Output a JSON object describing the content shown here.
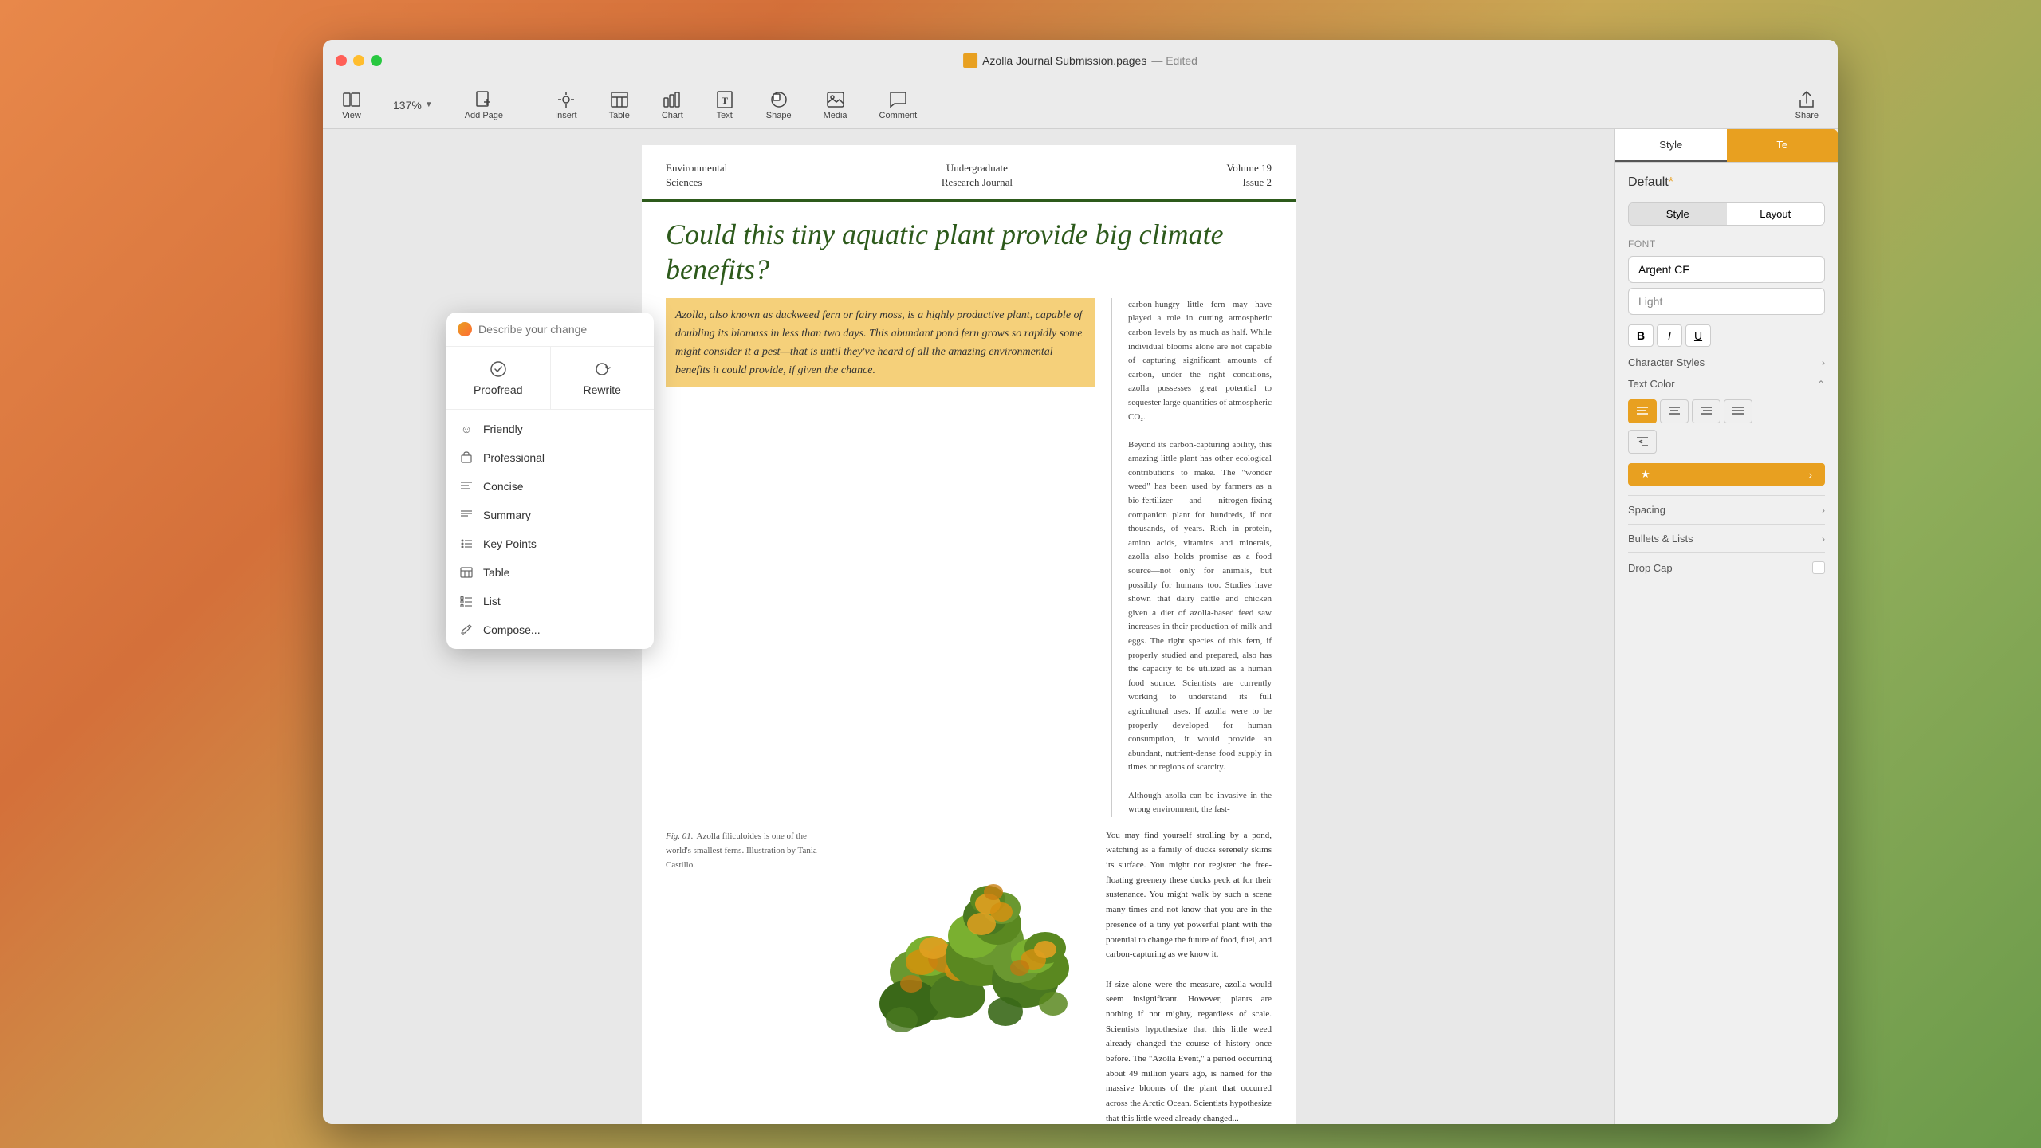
{
  "window": {
    "title": "Azolla Journal Submission.pages",
    "edited_label": "— Edited"
  },
  "toolbar": {
    "view_label": "View",
    "zoom_label": "137%",
    "add_page_label": "Add Page",
    "insert_label": "Insert",
    "table_label": "Table",
    "chart_label": "Chart",
    "text_label": "Text",
    "shape_label": "Shape",
    "media_label": "Media",
    "comment_label": "Comment",
    "share_label": "Share"
  },
  "format_panel": {
    "style_tab": "Style",
    "text_tab": "Te",
    "default_label": "Default",
    "style_label": "Style",
    "layout_label": "Layout",
    "font_section": "Font",
    "font_name": "Argent CF",
    "font_weight": "Light",
    "char_styles_label": "Character Styles",
    "text_color_label": "Text Color",
    "spacing_label": "Spacing",
    "bullets_label": "Bullets & Lists",
    "drop_cap_label": "Drop Cap"
  },
  "ai_popup": {
    "placeholder": "Describe your change",
    "proofread_label": "Proofread",
    "rewrite_label": "Rewrite",
    "menu_items": [
      {
        "icon": "smiley",
        "label": "Friendly"
      },
      {
        "icon": "briefcase",
        "label": "Professional"
      },
      {
        "icon": "lines",
        "label": "Concise"
      },
      {
        "icon": "lines",
        "label": "Summary"
      },
      {
        "icon": "bullet",
        "label": "Key Points"
      },
      {
        "icon": "table",
        "label": "Table"
      },
      {
        "icon": "list",
        "label": "List"
      },
      {
        "icon": "compose",
        "label": "Compose..."
      }
    ]
  },
  "document": {
    "journal_header": {
      "left_line1": "Environmental",
      "left_line2": "Sciences",
      "center_line1": "Undergraduate",
      "center_line2": "Research Journal",
      "right_line1": "Volume 19",
      "right_line2": "Issue 2"
    },
    "title": "Could this tiny aquatic plant provide big climate benefits?",
    "highlighted_paragraph": "Azolla, also known as duckweed fern or fairy moss, is a highly productive plant, capable of doubling its biomass in less than two days. This abundant pond fern grows so rapidly some might consider it a pest—that is until they've heard of all the amazing environmental benefits it could provide, if given the chance.",
    "sidebar_text": "carbon-hungry little fern may have played a role in cutting atmospheric carbon levels by as much as half. While individual blooms alone are not capable of capturing significant amounts of carbon, under the right conditions, azolla possesses great potential to sequester large quantities of atmospheric CO₂.\n\nBeyond its carbon-capturing ability, this amazing little plant has other ecological contributions to make. The \"wonder weed\" has been used by farmers as a bio-fertilizer and nitrogen-fixing companion plant for hundreds, if not thousands, of years. Rich in protein, amino acids, vitamins and minerals, azolla also holds promise as a food source—not only for animals, but possibly for humans too. Studies have shown that dairy cattle and chicken given a diet of azolla-based feed saw increases in their production of milk and eggs. The right species of this fern, if properly studied and prepared, also has the capacity to be utilized as a human food source. Scientists are currently working to understand its full agricultural uses. If azolla were to be properly developed for human consumption, it would provide an abundant, nutrient-dense food supply in times or regions of scarcity.\n\nAlthough azolla can be invasive in the wrong environment, the fast-",
    "caption_text": "Fig. 01. Azolla filiculoides is one of the world's smallest ferns. Illustration by Tania Castillo.",
    "body_text_col2": "You may find yourself strolling by a pond, watching as a family of ducks serenely skims its surface. You might not register the free-floating greenery these ducks peck at for their sustenance. You might walk by such a scene many times and not know that you are in the presence of a tiny yet powerful plant with the potential to change the future of food, fuel, and carbon-capturing as we know it.\n\nIf size alone were the measure, azolla would seem insignificant. However, plants are nothing if not mighty, regardless of scale. Scientists hypothesize that this little weed already changed the course..."
  },
  "colors": {
    "accent_orange": "#e8a020",
    "journal_green": "#2d5a1b",
    "highlight_yellow": "#f5d07a"
  }
}
